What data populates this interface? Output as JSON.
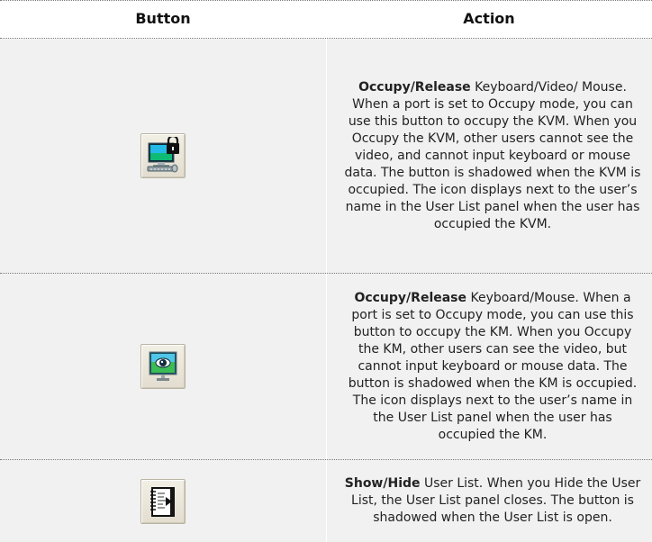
{
  "headers": {
    "button": "Button",
    "action": "Action"
  },
  "rows": [
    {
      "icon": "kvm-occupy-icon",
      "title": "Occupy/Release",
      "text": " Keyboard/Video/ Mouse. When a port is set to Occupy mode, you can use this button to occupy the KVM. When you Occupy the KVM, other users cannot see the video,  and cannot input keyboard or mouse data. The button is shadowed  when the KVM is occupied. The icon displays next to the user’s name in  the User List panel when the user has occupied the KVM."
    },
    {
      "icon": "km-occupy-icon",
      "title": "Occupy/Release",
      "text": " Keyboard/Mouse. When a port is set to Occupy mode, you can use this button to occupy the KM. When you Occupy the KM, other users can see the video, but  cannot input keyboard or mouse data. The button is shadowed when the  KM is occupied. The icon displays next to the user’s name in the User  List panel when the user has occupied the KM."
    },
    {
      "icon": "user-list-icon",
      "title": "Show/Hide",
      "text": " User List. When you Hide the User List, the User List panel  closes. The button is shadowed when the User List is open."
    }
  ],
  "colors": {
    "row_background": "#f1f1f1",
    "rule": "#7a7a7a"
  }
}
